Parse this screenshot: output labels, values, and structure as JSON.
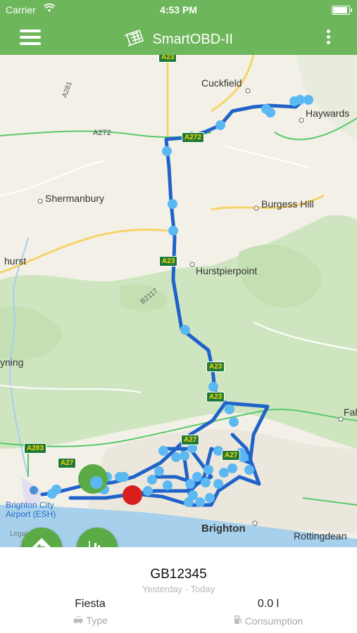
{
  "status": {
    "carrier": "Carrier",
    "time": "4:53 PM"
  },
  "nav": {
    "title": "SmartOBD-II"
  },
  "map": {
    "places": {
      "cuckfield": "Cuckfield",
      "haywards": "Haywards",
      "shermanbury": "Shermanbury",
      "burgess_hill": "Burgess Hill",
      "hurstpierpoint": "Hurstpierpoint",
      "hurst": "hurst",
      "yning": "yning",
      "fal": "Fal",
      "brighton": "Brighton",
      "rottingdean": "Rottingdean",
      "airport_line1": "Brighton City",
      "airport_line2": "Airport (ESH)",
      "legal": "Legal"
    },
    "roads": {
      "a23_top": "A23",
      "a281": "A281",
      "a272": "A272",
      "a272b": "A272",
      "a23_mid": "A23",
      "b2117": "B2117",
      "a23_low1": "A23",
      "a23_low2": "A23",
      "a27_a": "A27",
      "a27_b": "A27",
      "a283": "A283",
      "a27_c": "A27"
    }
  },
  "panel": {
    "vehicle_id": "GB12345",
    "date_range": "Yesterday - Today",
    "type_value": "Fiesta",
    "type_label": "Type",
    "consumption_value": "0.0 l",
    "consumption_label": "Consumption"
  },
  "colors": {
    "brand": "#6db65b",
    "route": "#1f63c9",
    "point": "#5bb8f2",
    "start": "#5aaa46",
    "end": "#d91e1e"
  }
}
